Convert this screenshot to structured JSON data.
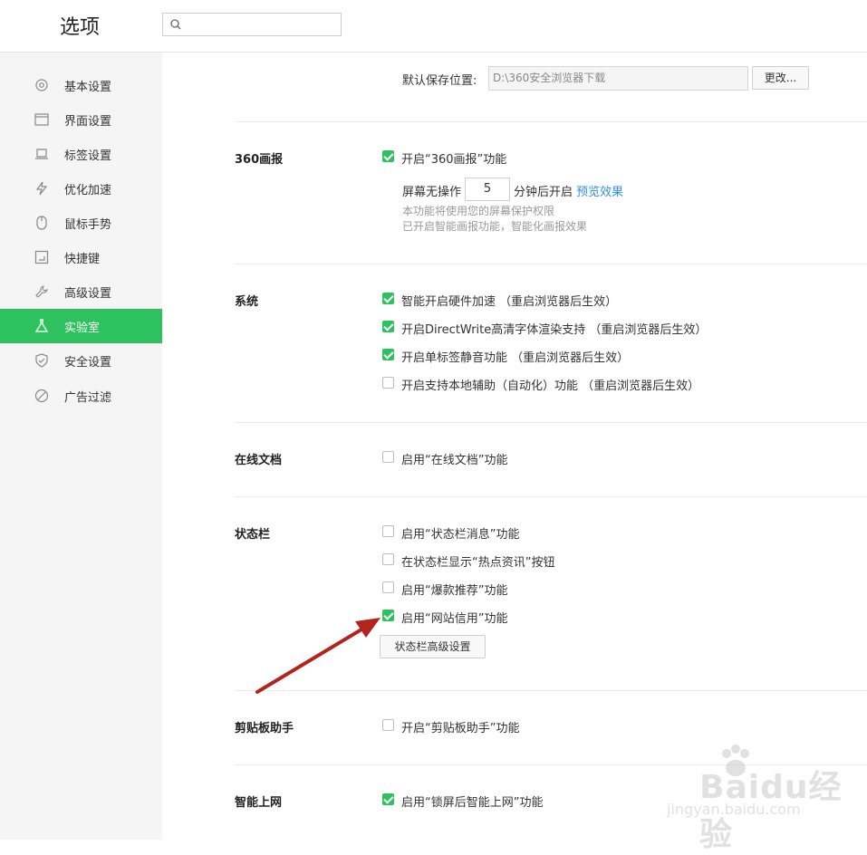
{
  "header": {
    "title": "选项",
    "search_placeholder": ""
  },
  "sidebar": {
    "items": [
      {
        "label": "基本设置",
        "icon": "gear-icon"
      },
      {
        "label": "界面设置",
        "icon": "window-icon"
      },
      {
        "label": "标签设置",
        "icon": "tab-icon"
      },
      {
        "label": "优化加速",
        "icon": "lightning-icon"
      },
      {
        "label": "鼠标手势",
        "icon": "mouse-icon"
      },
      {
        "label": "快捷键",
        "icon": "keyboard-icon"
      },
      {
        "label": "高级设置",
        "icon": "wrench-icon"
      },
      {
        "label": "实验室",
        "icon": "flask-icon",
        "active": true
      },
      {
        "label": "安全设置",
        "icon": "shield-icon"
      },
      {
        "label": "广告过滤",
        "icon": "block-icon"
      }
    ],
    "accent_color": "#2ec25f"
  },
  "download": {
    "label": "默认保存位置:",
    "path": "D:\\360安全浏览器下载",
    "change_button": "更改..."
  },
  "sections": {
    "huabao": {
      "title": "360画报",
      "enable_label": "开启“360画报”功能",
      "enable_checked": true,
      "idle_prefix": "屏幕无操作",
      "idle_value": "5",
      "idle_suffix": "分钟后开启",
      "preview_link": "预览效果",
      "note1": "本功能将使用您的屏幕保护权限",
      "note2": "已开启智能画报功能，智能化画报效果"
    },
    "system": {
      "title": "系统",
      "options": [
        {
          "label": "智能开启硬件加速 （重启浏览器后生效）",
          "checked": true
        },
        {
          "label": "开启DirectWrite高清字体渲染支持 （重启浏览器后生效）",
          "checked": true
        },
        {
          "label": "开启单标签静音功能 （重启浏览器后生效）",
          "checked": true
        },
        {
          "label": "开启支持本地辅助（自动化）功能 （重启浏览器后生效）",
          "checked": false
        }
      ]
    },
    "online_docs": {
      "title": "在线文档",
      "options": [
        {
          "label": "启用“在线文档”功能",
          "checked": false
        }
      ]
    },
    "statusbar": {
      "title": "状态栏",
      "options": [
        {
          "label": "启用“状态栏消息”功能",
          "checked": false
        },
        {
          "label": "在状态栏显示“热点资讯”按钮",
          "checked": false
        },
        {
          "label": "启用“爆款推荐”功能",
          "checked": false
        },
        {
          "label": "启用“网站信用”功能",
          "checked": true
        }
      ],
      "advanced_button": "状态栏高级设置"
    },
    "clipboard": {
      "title": "剪贴板助手",
      "options": [
        {
          "label": "开启“剪贴板助手”功能",
          "checked": false
        }
      ]
    },
    "smart_net": {
      "title": "智能上网",
      "options": [
        {
          "label": "启用“锁屏后智能上网”功能",
          "checked": true
        }
      ]
    }
  },
  "watermark": {
    "text": "Baidu经验",
    "sub": "jingyan.baidu.com"
  },
  "annotation": {
    "arrow_color": "#b5241c"
  }
}
